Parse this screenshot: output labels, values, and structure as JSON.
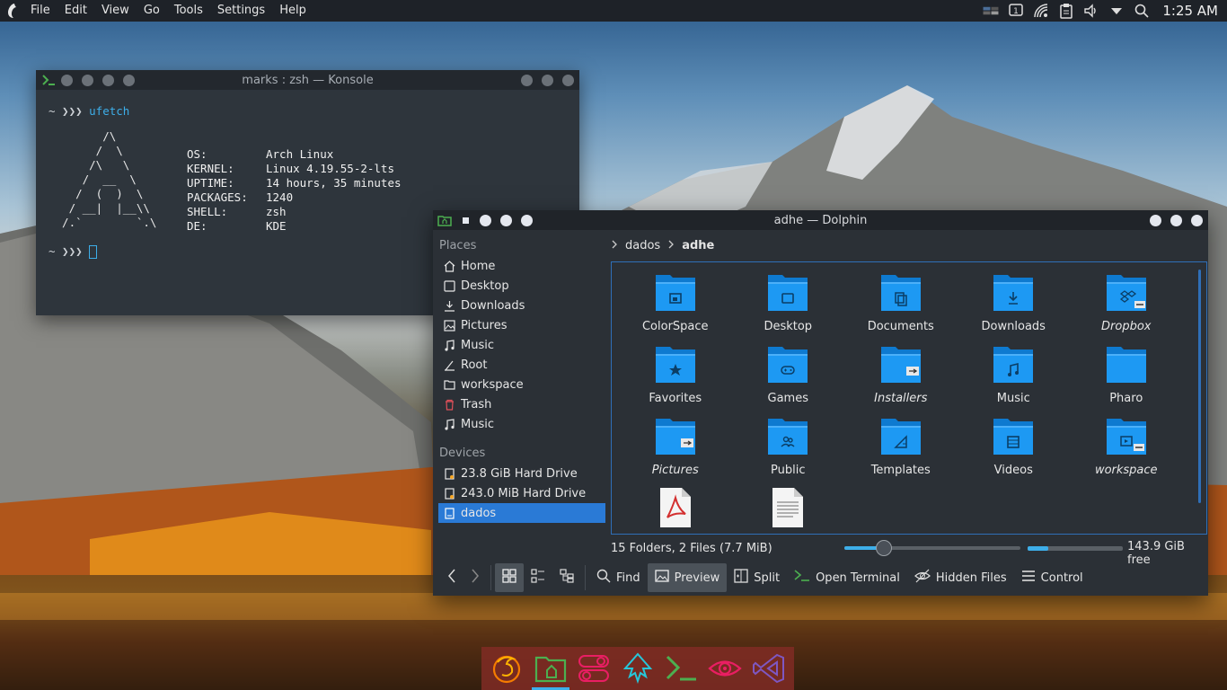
{
  "menubar": {
    "items": [
      "File",
      "Edit",
      "View",
      "Go",
      "Tools",
      "Settings",
      "Help"
    ],
    "clock": "1:25 AM",
    "tray_icons": [
      "workspace-switcher-icon",
      "notifications-icon",
      "wifi-icon",
      "clipboard-icon",
      "volume-icon",
      "dropdown-arrow-icon",
      "search-icon"
    ]
  },
  "konsole": {
    "title": "marks : zsh — Konsole",
    "prompt1": "~ ❯❯❯ ",
    "command": "ufetch",
    "ascii": "        /\\\n       /  \\\n      /\\   \\\n     /  __  \\\n    /  (  )  \\\n   / __|  |__\\\\\n  /.`        `.\\",
    "info": [
      {
        "key": "OS:",
        "value": "Arch Linux"
      },
      {
        "key": "KERNEL:",
        "value": "Linux 4.19.55-2-lts"
      },
      {
        "key": "UPTIME:",
        "value": "14 hours, 35 minutes"
      },
      {
        "key": "PACKAGES:",
        "value": "1240"
      },
      {
        "key": "SHELL:",
        "value": "zsh"
      },
      {
        "key": "DE:",
        "value": "KDE"
      }
    ],
    "prompt2": "~ ❯❯❯ "
  },
  "dolphin": {
    "title": "adhe — Dolphin",
    "places_title": "Places",
    "places": [
      {
        "label": "Home",
        "icon": "home-icon"
      },
      {
        "label": "Desktop",
        "icon": "desktop-icon"
      },
      {
        "label": "Downloads",
        "icon": "download-icon"
      },
      {
        "label": "Pictures",
        "icon": "pictures-icon"
      },
      {
        "label": "Music",
        "icon": "music-icon"
      },
      {
        "label": "Root",
        "icon": "root-icon"
      },
      {
        "label": "workspace",
        "icon": "folder-icon"
      },
      {
        "label": "Trash",
        "icon": "trash-icon"
      },
      {
        "label": "Music",
        "icon": "music-icon"
      }
    ],
    "devices_title": "Devices",
    "devices": [
      {
        "label": "23.8 GiB Hard Drive"
      },
      {
        "label": "243.0 MiB Hard Drive"
      },
      {
        "label": "dados"
      }
    ],
    "breadcrumb": [
      "dados",
      "adhe"
    ],
    "items": [
      {
        "label": "ColorSpace",
        "italic": false,
        "emblem": "window"
      },
      {
        "label": "Desktop",
        "italic": false,
        "emblem": "desktop"
      },
      {
        "label": "Documents",
        "italic": false,
        "emblem": "docs"
      },
      {
        "label": "Downloads",
        "italic": false,
        "emblem": "download"
      },
      {
        "label": "Dropbox",
        "italic": true,
        "emblem": "dropbox"
      },
      {
        "label": "Favorites",
        "italic": false,
        "emblem": "star"
      },
      {
        "label": "Games",
        "italic": false,
        "emblem": "gamepad"
      },
      {
        "label": "Installers",
        "italic": true,
        "emblem": "link"
      },
      {
        "label": "Music",
        "italic": false,
        "emblem": "music"
      },
      {
        "label": "Pharo",
        "italic": false,
        "emblem": "none"
      },
      {
        "label": "Pictures",
        "italic": true,
        "emblem": "link"
      },
      {
        "label": "Public",
        "italic": false,
        "emblem": "people"
      },
      {
        "label": "Templates",
        "italic": false,
        "emblem": "templates"
      },
      {
        "label": "Videos",
        "italic": false,
        "emblem": "video"
      },
      {
        "label": "workspace",
        "italic": true,
        "emblem": "workspace"
      }
    ],
    "files": [
      {
        "label": "",
        "type": "pdf"
      },
      {
        "label": "",
        "type": "text"
      }
    ],
    "status": "15 Folders, 2 Files (7.7 MiB)",
    "zoom_fraction": 0.22,
    "used_fraction": 0.22,
    "free_space": "143.9 GiB free",
    "toolbar": {
      "find": "Find",
      "preview": "Preview",
      "split": "Split",
      "open_terminal": "Open Terminal",
      "hidden_files": "Hidden Files",
      "control": "Control"
    }
  },
  "dock": {
    "apps": [
      "firefox-icon",
      "dolphin-icon",
      "settings-toggle-icon",
      "inkscape-icon",
      "konsole-icon",
      "eye-icon",
      "visual-studio-code-icon"
    ],
    "active": "dolphin-icon"
  },
  "colors": {
    "accent": "#3daee9",
    "folder": "#1d99f3",
    "selection": "#2a7ad6"
  }
}
